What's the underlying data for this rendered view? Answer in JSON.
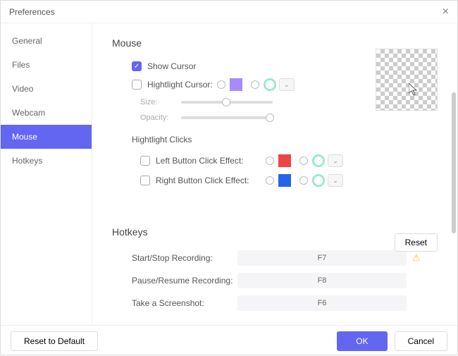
{
  "window": {
    "title": "Preferences"
  },
  "sidebar": {
    "items": [
      {
        "label": "General"
      },
      {
        "label": "Files"
      },
      {
        "label": "Video"
      },
      {
        "label": "Webcam"
      },
      {
        "label": "Mouse"
      },
      {
        "label": "Hotkeys"
      }
    ],
    "active_index": 4
  },
  "mouse": {
    "section_title": "Mouse",
    "show_cursor_label": "Show Cursor",
    "show_cursor_checked": true,
    "highlight_cursor_label": "Hightlight Cursor:",
    "highlight_cursor_checked": false,
    "highlight_color_solid": "#a78bfa",
    "size_label": "Size:",
    "opacity_label": "Opacity:",
    "highlight_clicks_title": "Hightlight Clicks",
    "left_click_label": "Left Button Click Effect:",
    "left_click_checked": false,
    "left_click_color": "#ef4444",
    "right_click_label": "Right Button Click Effect:",
    "right_click_checked": false,
    "right_click_color": "#2563eb",
    "reset_label": "Reset"
  },
  "hotkeys": {
    "section_title": "Hotkeys",
    "rows": [
      {
        "label": "Start/Stop Recording:",
        "key": "F7",
        "warn": true
      },
      {
        "label": "Pause/Resume Recording:",
        "key": "F8",
        "warn": false
      },
      {
        "label": "Take a Screenshot:",
        "key": "F6",
        "warn": false
      }
    ]
  },
  "footer": {
    "reset_default": "Reset to Default",
    "ok": "OK",
    "cancel": "Cancel"
  }
}
